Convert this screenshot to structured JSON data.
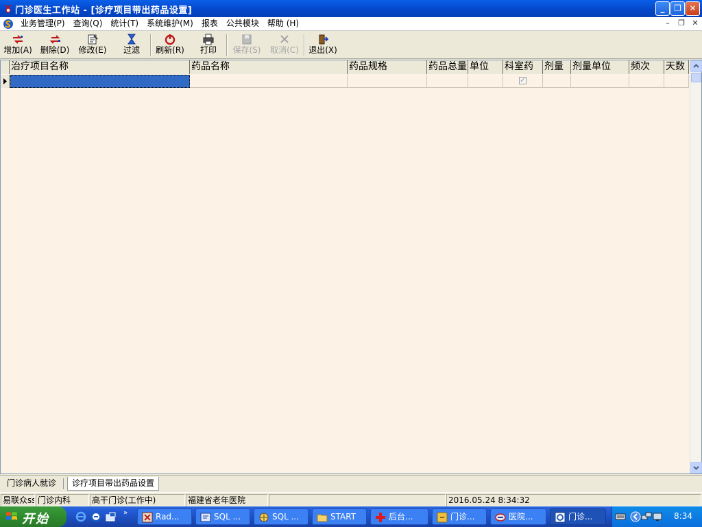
{
  "window": {
    "title": "门诊医生工作站 - [诊疗项目带出药品设置]",
    "controls": {
      "minimize": "_",
      "restore": "❐",
      "close": "✕"
    }
  },
  "menu": {
    "items": [
      {
        "label": "业务管理(P)"
      },
      {
        "label": "查询(Q)"
      },
      {
        "label": "统计(T)"
      },
      {
        "label": "系统维护(M)"
      },
      {
        "label": "报表"
      },
      {
        "label": "公共模块"
      },
      {
        "label": "帮助 (H)"
      }
    ],
    "mdi_controls": {
      "minimize": "–",
      "restore": "❐",
      "close": "✕"
    }
  },
  "toolbar": {
    "buttons": [
      {
        "label": "增加(A)",
        "icon": "add-icon",
        "enabled": true
      },
      {
        "label": "删除(D)",
        "icon": "delete-icon",
        "enabled": true
      },
      {
        "label": "修改(E)",
        "icon": "edit-icon",
        "enabled": true
      },
      {
        "label": "过滤",
        "icon": "filter-icon",
        "enabled": true
      },
      {
        "label": "刷新(R)",
        "icon": "refresh-icon",
        "enabled": true
      },
      {
        "label": "打印",
        "icon": "print-icon",
        "enabled": true
      },
      {
        "label": "保存(S)",
        "icon": "save-icon",
        "enabled": false
      },
      {
        "label": "取消(C)",
        "icon": "cancel-icon",
        "enabled": false
      },
      {
        "label": "退出(X)",
        "icon": "exit-icon",
        "enabled": true
      }
    ]
  },
  "grid": {
    "columns": [
      {
        "label": "治疗项目名称"
      },
      {
        "label": "药品名称"
      },
      {
        "label": "药品规格"
      },
      {
        "label": "药品总量"
      },
      {
        "label": "单位"
      },
      {
        "label": "科室药"
      },
      {
        "label": "剂量"
      },
      {
        "label": "剂量单位"
      },
      {
        "label": "频次"
      },
      {
        "label": "天数"
      }
    ],
    "rows": [
      {
        "treatment_item": "",
        "drug_name": "",
        "drug_spec": "",
        "drug_total": "",
        "unit": "",
        "dept_drug": true,
        "dose": "",
        "dose_unit": "",
        "frequency": "",
        "days": ""
      }
    ]
  },
  "mdi_tabs": [
    {
      "label": "门诊病人就诊",
      "active": false
    },
    {
      "label": "诊疗项目带出药品设置",
      "active": true
    }
  ],
  "status": {
    "user": "易联众ss",
    "department": "门诊内科",
    "clinic": "高干门诊(工作中)",
    "hospital": "福建省老年医院",
    "blank": "",
    "datetime": "2016.05.24 8:34:32"
  },
  "taskbar": {
    "start_label": "开始",
    "tasks": [
      {
        "label": "Rad...",
        "icon": "rad-icon"
      },
      {
        "label": "SQL ...",
        "icon": "sql-icon"
      },
      {
        "label": "SQL ...",
        "icon": "sql-server-icon"
      },
      {
        "label": "START",
        "icon": "folder-icon"
      },
      {
        "label": "后台...",
        "icon": "red-cross-icon"
      },
      {
        "label": "门诊...",
        "icon": "clinic-icon"
      },
      {
        "label": "医院...",
        "icon": "hospital-icon"
      },
      {
        "label": "门诊...",
        "icon": "clinic-app-icon"
      }
    ],
    "clock": "8:34"
  }
}
